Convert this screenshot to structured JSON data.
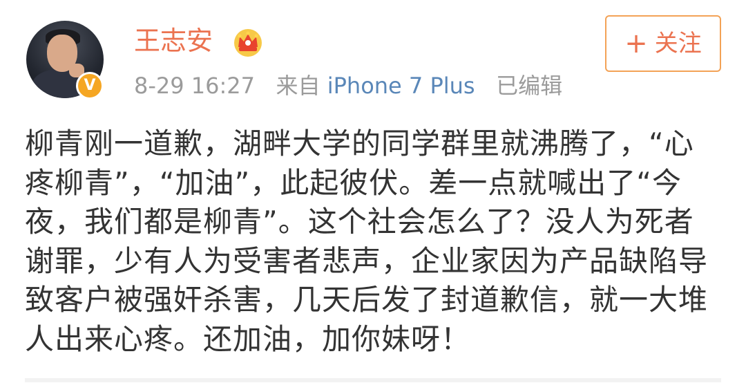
{
  "post": {
    "author": {
      "name": "王志安",
      "verified_badge": "V",
      "avatar_icon": "user-avatar",
      "crown_icon": "crown-icon"
    },
    "follow_button": {
      "plus": "+",
      "label": "关注"
    },
    "meta": {
      "date": "8-29 16:27",
      "from_prefix": "来自",
      "source": "iPhone 7 Plus",
      "edited": "已编辑"
    },
    "text": "柳青刚一道歉，湖畔大学的同学群里就沸腾了，“心疼柳青”，“加油”，此起彼伏。差一点就喊出了“今夜，我们都是柳青”。这个社会怎么了？没人为死者谢罪，少有人为受害者悲声，企业家因为产品缺陷导致客户被强奸杀害，几天后发了封道歉信，就一大堆人出来心疼。还加油，加你妹呀！"
  },
  "colors": {
    "accent": "#eb7350",
    "button_border": "#f3a256",
    "source_link": "#5a87b8",
    "meta_gray": "#9b9b9b",
    "body_text": "#333333",
    "badge": "#f5a623"
  }
}
